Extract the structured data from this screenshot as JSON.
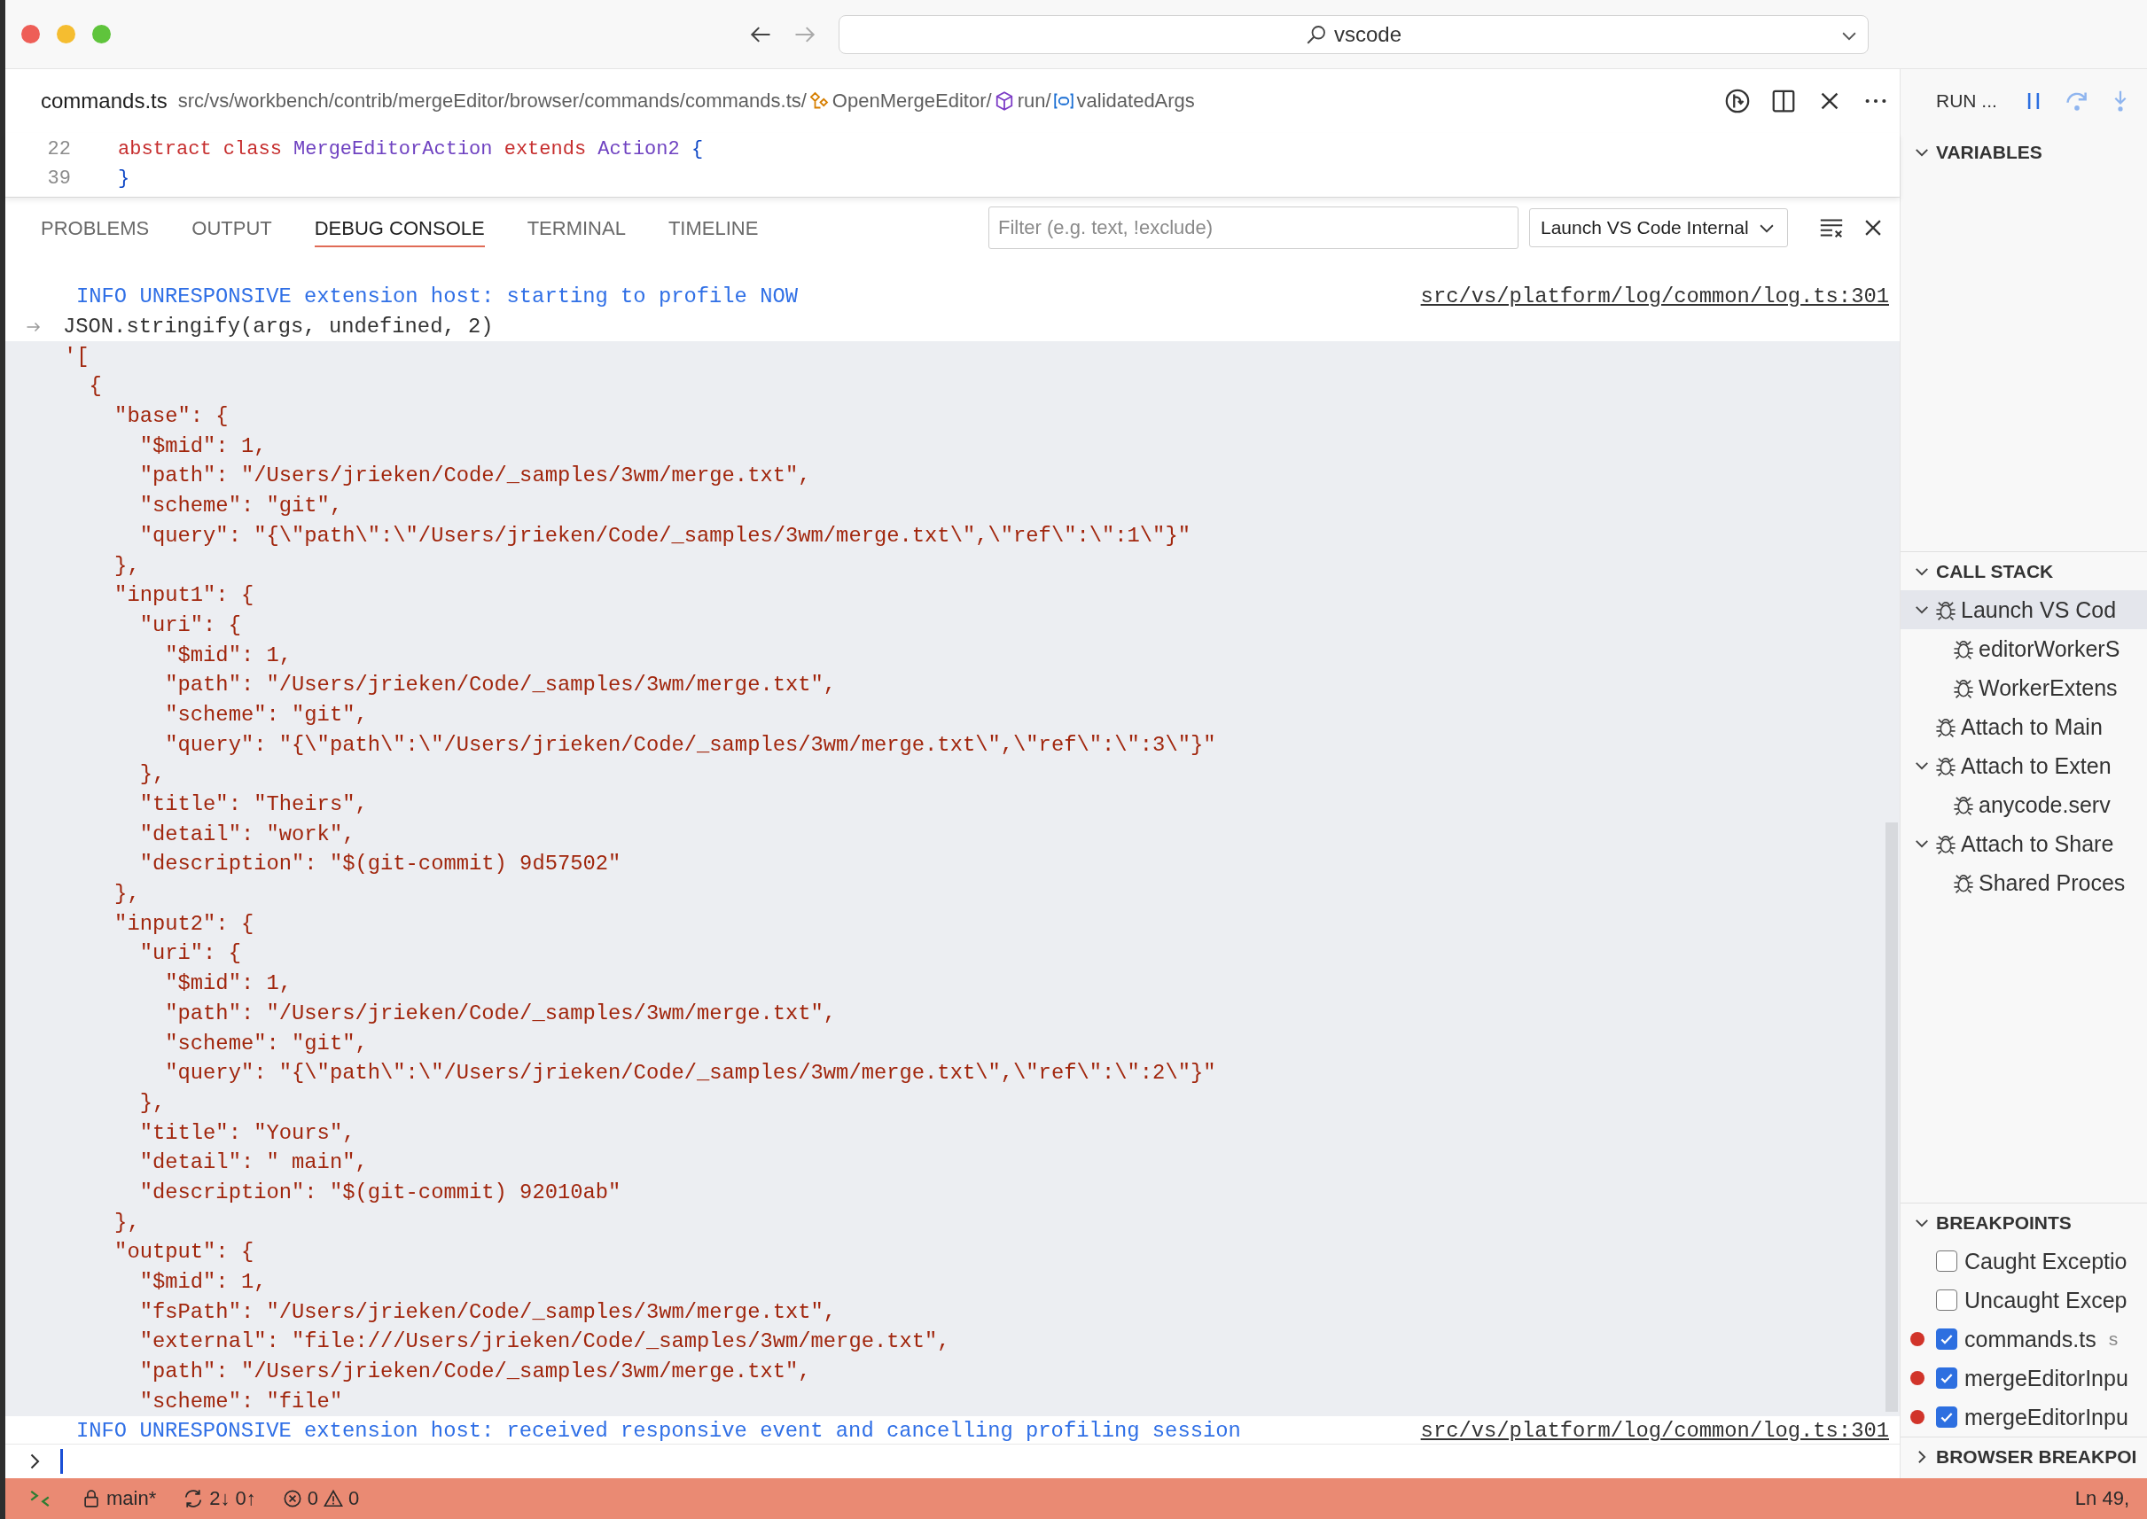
{
  "title_bar": {
    "search": "vscode"
  },
  "editor": {
    "file_name": "commands.ts",
    "path": "src/vs/workbench/contrib/mergeEditor/browser/commands/commands.ts/",
    "breadcrumbs": [
      {
        "kind": "class",
        "label": "OpenMergeEditor/"
      },
      {
        "kind": "method",
        "label": "run/"
      },
      {
        "kind": "variable",
        "label": "validatedArgs"
      }
    ],
    "sticky_lines": [
      {
        "line_number": "22",
        "tokens": [
          {
            "kind": "keyword",
            "text": "abstract class "
          },
          {
            "kind": "type",
            "text": "MergeEditorAction "
          },
          {
            "kind": "keyword",
            "text": "extends "
          },
          {
            "kind": "type",
            "text": "Action2 "
          },
          {
            "kind": "punct",
            "text": "{"
          }
        ]
      },
      {
        "line_number": "39",
        "tokens": [
          {
            "kind": "punct",
            "text": "}"
          }
        ]
      }
    ]
  },
  "panel": {
    "tabs": [
      {
        "label": "PROBLEMS",
        "selected": false
      },
      {
        "label": "OUTPUT",
        "selected": false
      },
      {
        "label": "DEBUG CONSOLE",
        "selected": true
      },
      {
        "label": "TERMINAL",
        "selected": false
      },
      {
        "label": "TIMELINE",
        "selected": false
      }
    ],
    "filter": {
      "placeholder": "Filter (e.g. text, !exclude)"
    },
    "session": "Launch VS Code Internal"
  },
  "console": {
    "lines": [
      {
        "kind": "info",
        "text": "INFO UNRESPONSIVE extension host: starting to profile NOW",
        "source": "src/vs/platform/log/common/log.ts:301"
      },
      {
        "kind": "echo",
        "text": "JSON.stringify(args, undefined, 2)"
      },
      {
        "kind": "output",
        "text": "'["
      },
      {
        "kind": "output",
        "text": "  {"
      },
      {
        "kind": "output",
        "text": "    \"base\": {"
      },
      {
        "kind": "output",
        "text": "      \"$mid\": 1,"
      },
      {
        "kind": "output",
        "text": "      \"path\": \"/Users/jrieken/Code/_samples/3wm/merge.txt\","
      },
      {
        "kind": "output",
        "text": "      \"scheme\": \"git\","
      },
      {
        "kind": "output",
        "text": "      \"query\": \"{\\\"path\\\":\\\"/Users/jrieken/Code/_samples/3wm/merge.txt\\\",\\\"ref\\\":\\\":1\\\"}\""
      },
      {
        "kind": "output",
        "text": "    },"
      },
      {
        "kind": "output",
        "text": "    \"input1\": {"
      },
      {
        "kind": "output",
        "text": "      \"uri\": {"
      },
      {
        "kind": "output",
        "text": "        \"$mid\": 1,"
      },
      {
        "kind": "output",
        "text": "        \"path\": \"/Users/jrieken/Code/_samples/3wm/merge.txt\","
      },
      {
        "kind": "output",
        "text": "        \"scheme\": \"git\","
      },
      {
        "kind": "output",
        "text": "        \"query\": \"{\\\"path\\\":\\\"/Users/jrieken/Code/_samples/3wm/merge.txt\\\",\\\"ref\\\":\\\":3\\\"}\""
      },
      {
        "kind": "output",
        "text": "      },"
      },
      {
        "kind": "output",
        "text": "      \"title\": \"Theirs\","
      },
      {
        "kind": "output",
        "text": "      \"detail\": \"work\","
      },
      {
        "kind": "output",
        "text": "      \"description\": \"$(git-commit) 9d57502\""
      },
      {
        "kind": "output",
        "text": "    },"
      },
      {
        "kind": "output",
        "text": "    \"input2\": {"
      },
      {
        "kind": "output",
        "text": "      \"uri\": {"
      },
      {
        "kind": "output",
        "text": "        \"$mid\": 1,"
      },
      {
        "kind": "output",
        "text": "        \"path\": \"/Users/jrieken/Code/_samples/3wm/merge.txt\","
      },
      {
        "kind": "output",
        "text": "        \"scheme\": \"git\","
      },
      {
        "kind": "output",
        "text": "        \"query\": \"{\\\"path\\\":\\\"/Users/jrieken/Code/_samples/3wm/merge.txt\\\",\\\"ref\\\":\\\":2\\\"}\""
      },
      {
        "kind": "output",
        "text": "      },"
      },
      {
        "kind": "output",
        "text": "      \"title\": \"Yours\","
      },
      {
        "kind": "output",
        "text": "      \"detail\": \" main\","
      },
      {
        "kind": "output",
        "text": "      \"description\": \"$(git-commit) 92010ab\""
      },
      {
        "kind": "output",
        "text": "    },"
      },
      {
        "kind": "output",
        "text": "    \"output\": {"
      },
      {
        "kind": "output",
        "text": "      \"$mid\": 1,"
      },
      {
        "kind": "output",
        "text": "      \"fsPath\": \"/Users/jrieken/Code/_samples/3wm/merge.txt\","
      },
      {
        "kind": "output",
        "text": "      \"external\": \"file:///Users/jrieken/Code/_samples/3wm/merge.txt\","
      },
      {
        "kind": "output",
        "text": "      \"path\": \"/Users/jrieken/Code/_samples/3wm/merge.txt\","
      },
      {
        "kind": "output",
        "text": "      \"scheme\": \"file\""
      },
      {
        "kind": "info",
        "text": "INFO UNRESPONSIVE extension host: received responsive event and cancelling profiling session",
        "source": "src/vs/platform/log/common/log.ts:301"
      }
    ]
  },
  "sidebar": {
    "title": "RUN ...",
    "variables": {
      "title": "VARIABLES",
      "expanded": true
    },
    "call_stack": {
      "title": "CALL STACK",
      "expanded": true,
      "items": [
        {
          "label": "Launch VS Cod",
          "selected": true,
          "expanded": true,
          "children": [
            {
              "label": "editorWorkerS",
              "selected": false
            },
            {
              "label": "WorkerExtens",
              "selected": false
            }
          ]
        },
        {
          "label": "Attach to Main",
          "selected": false
        },
        {
          "label": "Attach to Exten",
          "selected": false,
          "expanded": true,
          "children": [
            {
              "label": "anycode.serv",
              "selected": false
            }
          ]
        },
        {
          "label": "Attach to Share",
          "selected": false,
          "expanded": true,
          "children": [
            {
              "label": "Shared Proces",
              "selected": false
            }
          ]
        }
      ]
    },
    "breakpoints": {
      "title": "BREAKPOINTS",
      "expanded": true,
      "items": [
        {
          "kind": "exception",
          "label": "Caught Exceptio",
          "checked": false
        },
        {
          "kind": "exception",
          "label": "Uncaught Excep",
          "checked": false
        },
        {
          "kind": "file",
          "label": "commands.ts",
          "checked": true,
          "description": "s"
        },
        {
          "kind": "file",
          "label": "mergeEditorInpu",
          "checked": true
        },
        {
          "kind": "file",
          "label": "mergeEditorInpu",
          "checked": true
        }
      ]
    },
    "browser_breakpoints": {
      "title": "BROWSER BREAKPOI",
      "expanded": false
    }
  },
  "status_bar": {
    "branch": "main*",
    "sync": "2↓ 0↑",
    "errors": "0",
    "warnings": "0",
    "position": "Ln 49,"
  }
}
